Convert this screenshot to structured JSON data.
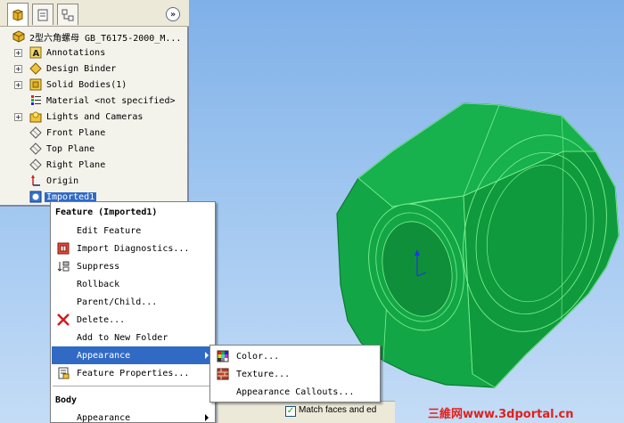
{
  "tree": {
    "root": "2型六角螺母 GB_T6175-2000_M...",
    "items": [
      {
        "label": "Annotations",
        "expandable": true,
        "icon": "annotations-icon"
      },
      {
        "label": "Design Binder",
        "expandable": true,
        "icon": "design-binder-icon"
      },
      {
        "label": "Solid Bodies(1)",
        "expandable": true,
        "icon": "solid-bodies-icon"
      },
      {
        "label": "Material <not specified>",
        "expandable": false,
        "icon": "material-icon"
      },
      {
        "label": "Lights and Cameras",
        "expandable": true,
        "icon": "lights-icon"
      },
      {
        "label": "Front Plane",
        "expandable": false,
        "icon": "plane-icon"
      },
      {
        "label": "Top Plane",
        "expandable": false,
        "icon": "plane-icon"
      },
      {
        "label": "Right Plane",
        "expandable": false,
        "icon": "plane-icon"
      },
      {
        "label": "Origin",
        "expandable": false,
        "icon": "origin-icon"
      },
      {
        "label": "Imported1",
        "expandable": false,
        "icon": "imported-feature-icon",
        "selected": true
      }
    ]
  },
  "context_menu": {
    "header_feature": "Feature (Imported1)",
    "items": [
      {
        "label": "Edit Feature",
        "icon": ""
      },
      {
        "label": "Import Diagnostics...",
        "icon": "import-diagnostics-icon"
      },
      {
        "label": "Suppress",
        "icon": "suppress-icon"
      },
      {
        "label": "Rollback",
        "icon": ""
      },
      {
        "label": "Parent/Child...",
        "icon": ""
      },
      {
        "label": "Delete...",
        "icon": "delete-icon"
      },
      {
        "label": "Add to New Folder",
        "icon": ""
      },
      {
        "label": "Appearance",
        "icon": "",
        "submenu": true,
        "hover": true
      },
      {
        "label": "Feature Properties...",
        "icon": "feature-properties-icon"
      }
    ],
    "header_body": "Body",
    "body_items": [
      {
        "label": "Appearance",
        "submenu": true
      }
    ]
  },
  "submenu": {
    "items": [
      {
        "label": "Color...",
        "icon": "color-palette-icon"
      },
      {
        "label": "Texture...",
        "icon": "texture-icon"
      },
      {
        "label": "Appearance Callouts...",
        "icon": ""
      }
    ]
  },
  "property_strip": {
    "checkbox_label": "Match faces and ed",
    "checked": true
  },
  "watermark": "三維网www.3dportal.cn",
  "colors": {
    "part_green": "#13a646",
    "part_edge": "#7cf28e",
    "menu_highlight": "#316ac5",
    "background_top": "#7fb0e8"
  }
}
